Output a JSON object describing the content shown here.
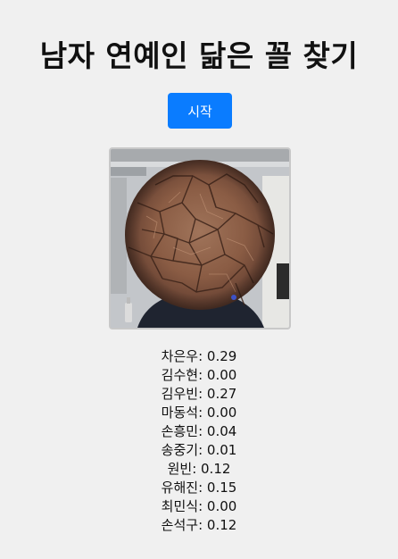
{
  "page": {
    "title": "남자 연예인 닮은 꼴 찾기",
    "start_button_label": "시작"
  },
  "webcam": {
    "icon": "webcam-preview"
  },
  "results": [
    {
      "name": "차은우",
      "score": "0.29"
    },
    {
      "name": "김수현",
      "score": "0.00"
    },
    {
      "name": "김우빈",
      "score": "0.27"
    },
    {
      "name": "마동석",
      "score": "0.00"
    },
    {
      "name": "손흥민",
      "score": "0.04"
    },
    {
      "name": "송중기",
      "score": "0.01"
    },
    {
      "name": "원빈",
      "score": "0.12"
    },
    {
      "name": "유해진",
      "score": "0.15"
    },
    {
      "name": "최민식",
      "score": "0.00"
    },
    {
      "name": "손석구",
      "score": "0.12"
    }
  ],
  "colors": {
    "background": "#f0f0f0",
    "button": "#0a7cff",
    "text": "#111111"
  }
}
